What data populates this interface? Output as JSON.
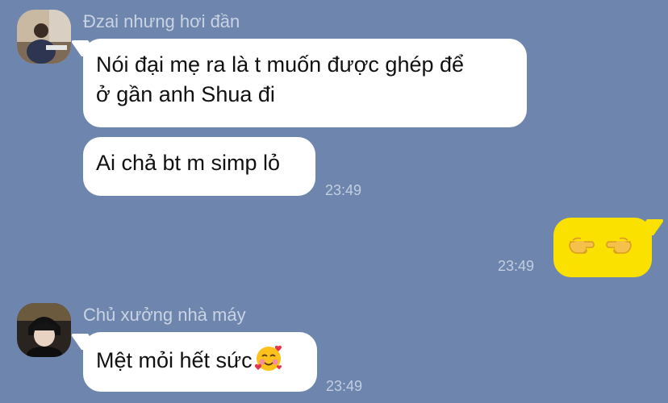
{
  "messages": [
    {
      "sender": "Đzai nhưng hơi đần",
      "avatar_icon": "profile-photo",
      "bubbles": [
        {
          "line1": "Nói đại mẹ ra là t muốn được ghép để",
          "line2": "ở gần anh Shua đi"
        },
        {
          "text": "Ai chả bt m simp lỏ",
          "time": "23:49"
        }
      ]
    },
    {
      "from_me": true,
      "emoji_icons": [
        "backhand-index-pointing-right-icon",
        "backhand-index-pointing-left-icon"
      ],
      "time": "23:49",
      "bubble_color": "#fae100"
    },
    {
      "sender": "Chủ xưởng nhà máy",
      "avatar_icon": "profile-photo",
      "bubbles": [
        {
          "text": "Mệt mỏi hết sức",
          "emoji_icon": "smiling-face-with-hearts-icon",
          "time": "23:49"
        }
      ]
    }
  ],
  "colors": {
    "background": "#6e86ad",
    "bubble_incoming": "#ffffff",
    "bubble_outgoing": "#fae100"
  }
}
